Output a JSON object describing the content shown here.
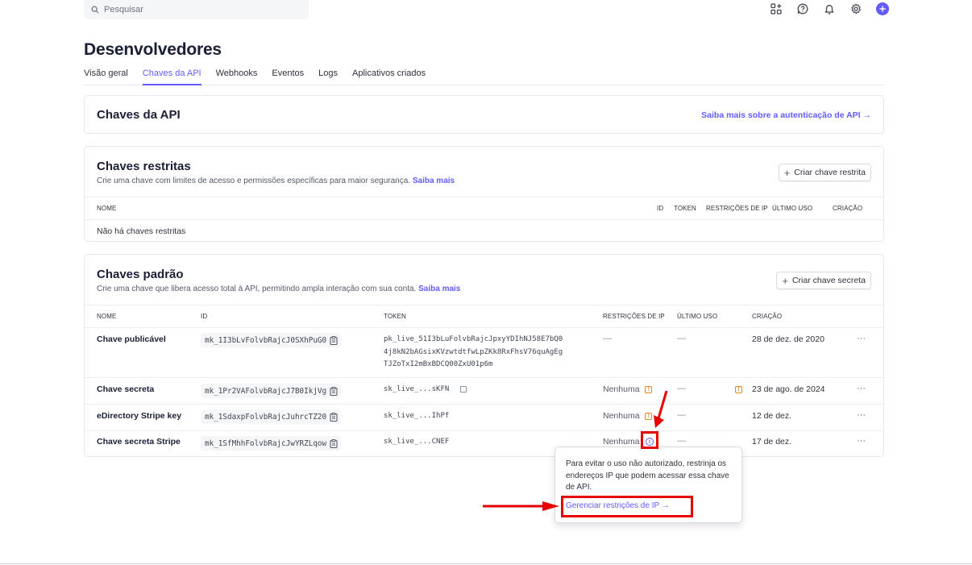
{
  "search": {
    "placeholder": "Pesquisar"
  },
  "top_icons": [
    "apps-icon",
    "help-icon",
    "bell-icon",
    "gear-icon",
    "plus-icon"
  ],
  "page": {
    "title": "Desenvolvedores"
  },
  "tabs": [
    {
      "label": "Visão geral",
      "active": false
    },
    {
      "label": "Chaves da API",
      "active": true
    },
    {
      "label": "Webhooks",
      "active": false
    },
    {
      "label": "Eventos",
      "active": false
    },
    {
      "label": "Logs",
      "active": false
    },
    {
      "label": "Aplicativos criados",
      "active": false
    }
  ],
  "api_keys_card": {
    "title": "Chaves da API",
    "link": "Saiba mais sobre a autenticação de API →"
  },
  "restricted_card": {
    "title": "Chaves restritas",
    "subtitle": "Crie uma chave com limites de acesso e permissões específicas para maior segurança.",
    "subtitle_link": "Saiba mais",
    "button": "Criar chave restrita",
    "columns": [
      "NOME",
      "ID",
      "TOKEN",
      "RESTRIÇÕES DE IP",
      "ÚLTIMO USO",
      "CRIAÇÃO"
    ],
    "empty": "Não há chaves restritas"
  },
  "standard_card": {
    "title": "Chaves padrão",
    "subtitle": "Crie uma chave que libera acesso total à API, permitindo ampla interação com sua conta.",
    "subtitle_link": "Saiba mais",
    "button": "Criar chave secreta",
    "columns": [
      "NOME",
      "ID",
      "TOKEN",
      "RESTRIÇÕES DE IP",
      "ÚLTIMO USO",
      "CRIAÇÃO"
    ],
    "rows": [
      {
        "name": "Chave publicável",
        "id": "mk_1I3bLvFolvbRajcJ0SXhPuG0",
        "token_lines": [
          "pk_live_51I3bLuFolvbRajcJpxyYDIhNJ58E7bQ0",
          "4j8kN2bAGsixKVzwtdtfwLpZKk8RxFhsV76quAgEg",
          "TJZoTxI2mBxBDCQ00ZxU01p6m"
        ],
        "ip": "—",
        "last_used": "—",
        "created": "28 de dez. de 2020"
      },
      {
        "name": "Chave secreta",
        "id": "mk_1Pr2VAFolvbRajcJ7B0IkjVg",
        "token": "sk_live_...sKFN",
        "ip": "Nenhuma",
        "last_used": "—",
        "created": "23 de ago. de 2024"
      },
      {
        "name": "eDirectory Stripe key",
        "id": "mk_1SdaxpFolvbRajcJuhrcTZ20",
        "token": "sk_live_...IhPf",
        "ip": "Nenhuma",
        "last_used": "—",
        "created": "12 de dez."
      },
      {
        "name": "Chave secreta Stripe",
        "id": "mk_1SfMhhFolvbRajcJwYRZLqow",
        "token": "sk_live_...CNEF",
        "ip": "Nenhuma",
        "last_used": "—",
        "created": "17 de dez."
      }
    ],
    "more": "···"
  },
  "popover": {
    "text": "Para evitar o uso não autorizado, restrinja os endereços IP que podem acessar essa chave de API.",
    "link": "Gerenciar restrições de IP →"
  },
  "colors": {
    "accent": "#635bff",
    "warning": "#e5851b",
    "annotation": "#e60000"
  }
}
